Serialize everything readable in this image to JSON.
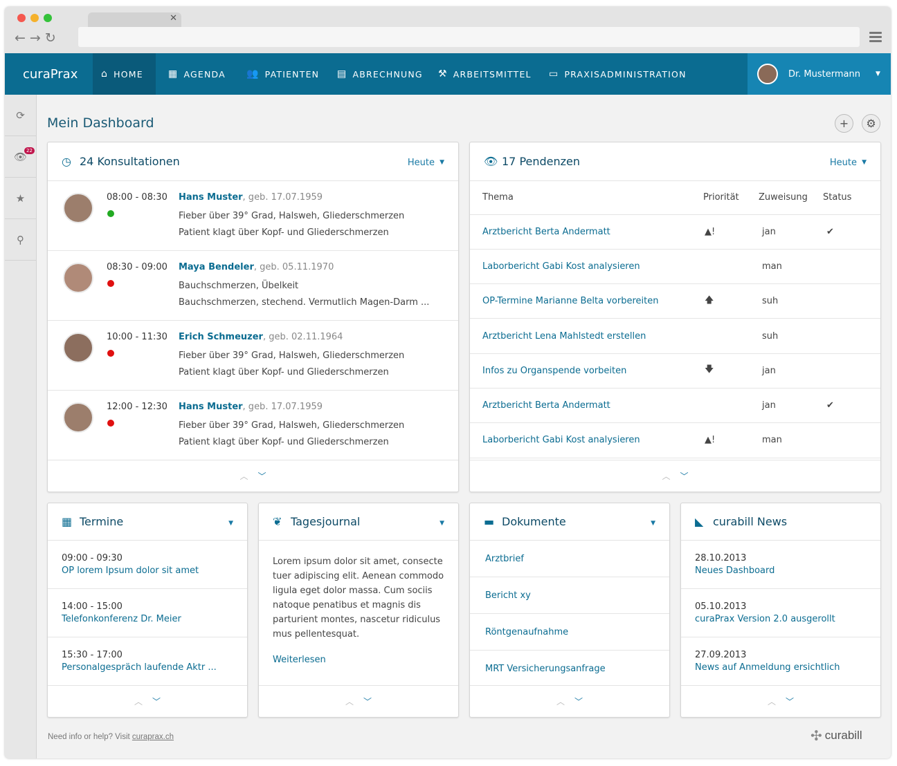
{
  "brand": "curaPrax",
  "nav": [
    {
      "icon": "home-icon",
      "label": "HOME"
    },
    {
      "icon": "calendar-icon",
      "label": "AGENDA"
    },
    {
      "icon": "patients-icon",
      "label": "PATIENTEN"
    },
    {
      "icon": "calculator-icon",
      "label": "ABRECHNUNG"
    },
    {
      "icon": "toolbox-icon",
      "label": "ARBEITSMITTEL"
    },
    {
      "icon": "monitor-icon",
      "label": "PRAXISADMINISTRATION"
    }
  ],
  "user": {
    "name": "Dr. Mustermann"
  },
  "sidebar": {
    "badge": "22"
  },
  "page_title": "Mein Dashboard",
  "konsultationen": {
    "title": "24 Konsultationen",
    "filter": "Heute",
    "items": [
      {
        "time": "08:00 - 08:30",
        "status": "green",
        "name": "Hans Muster",
        "dob": ", geb. 17.07.1959",
        "line1": "Fieber über 39° Grad, Halsweh, Gliederschmerzen",
        "line2": "Patient klagt über Kopf- und Gliederschmerzen"
      },
      {
        "time": "08:30 - 09:00",
        "status": "red",
        "name": "Maya Bendeler",
        "dob": ", geb. 05.11.1970",
        "line1": "Bauchschmerzen, Übelkeit",
        "line2": "Bauchschmerzen, stechend. Vermutlich Magen-Darm ..."
      },
      {
        "time": "10:00 - 11:30",
        "status": "red",
        "name": "Erich Schmeuzer",
        "dob": ", geb. 02.11.1964",
        "line1": "Fieber über 39° Grad, Halsweh, Gliederschmerzen",
        "line2": "Patient klagt über Kopf- und Gliederschmerzen"
      },
      {
        "time": "12:00 - 12:30",
        "status": "red",
        "name": "Hans Muster",
        "dob": ", geb. 17.07.1959",
        "line1": "Fieber über 39° Grad, Halsweh, Gliederschmerzen",
        "line2": "Patient klagt über Kopf- und Gliederschmerzen"
      }
    ]
  },
  "pendenzen": {
    "title": "17 Pendenzen",
    "filter": "Heute",
    "columns": [
      "Thema",
      "Priorität",
      "Zuweisung",
      "Status"
    ],
    "rows": [
      {
        "thema": "Arztbericht Berta Andermatt",
        "prio": "▲!",
        "zuweisung": "jan",
        "status": "✔"
      },
      {
        "thema": "Laborbericht Gabi Kost analysieren",
        "prio": "",
        "zuweisung": "man",
        "status": ""
      },
      {
        "thema": "OP-Termine Marianne Belta vorbereiten",
        "prio": "🡅",
        "zuweisung": "suh",
        "status": ""
      },
      {
        "thema": "Arztbericht Lena Mahlstedt erstellen",
        "prio": "",
        "zuweisung": "suh",
        "status": ""
      },
      {
        "thema": "Infos zu Organspende vorbeiten",
        "prio": "🡇",
        "zuweisung": "jan",
        "status": ""
      },
      {
        "thema": "Arztbericht Berta Andermatt",
        "prio": "",
        "zuweisung": "jan",
        "status": "✔"
      },
      {
        "thema": "Laborbericht Gabi Kost analysieren",
        "prio": "▲!",
        "zuweisung": "man",
        "status": ""
      }
    ]
  },
  "termine": {
    "title": "Termine",
    "items": [
      {
        "time": "09:00 - 09:30",
        "label": "OP lorem Ipsum dolor sit amet"
      },
      {
        "time": "14:00 - 15:00",
        "label": "Telefonkonferenz Dr. Meier"
      },
      {
        "time": "15:30 - 17:00",
        "label": "Personalgespräch laufende Aktr ..."
      }
    ]
  },
  "tagesjournal": {
    "title": "Tagesjournal",
    "text": "Lorem ipsum dolor sit amet, consecte tuer adipiscing elit. Aenean commodo ligula eget dolor massa. Cum sociis natoque penatibus et magnis dis parturient montes, nascetur ridiculus mus pellentesquat.",
    "more": "Weiterlesen"
  },
  "dokumente": {
    "title": "Dokumente",
    "items": [
      "Arztbrief",
      "Bericht xy",
      "Röntgenaufnahme",
      "MRT Versicherungsanfrage"
    ]
  },
  "news": {
    "title": "curabill News",
    "items": [
      {
        "date": "28.10.2013",
        "label": "Neues Dashboard"
      },
      {
        "date": "05.10.2013",
        "label": "curaPrax Version 2.0 ausgerollt"
      },
      {
        "date": "27.09.2013",
        "label": "News auf Anmeldung ersichtlich"
      }
    ]
  },
  "footer": {
    "text": "Need info or help? Visit ",
    "link": "curaprax.ch",
    "logo": "curabill"
  },
  "colors": {
    "accent": "#0b6c91",
    "nav_active": "#0a5a7a",
    "user_bg": "#1685b3",
    "status_green": "#22aa22",
    "status_red": "#e01010"
  }
}
